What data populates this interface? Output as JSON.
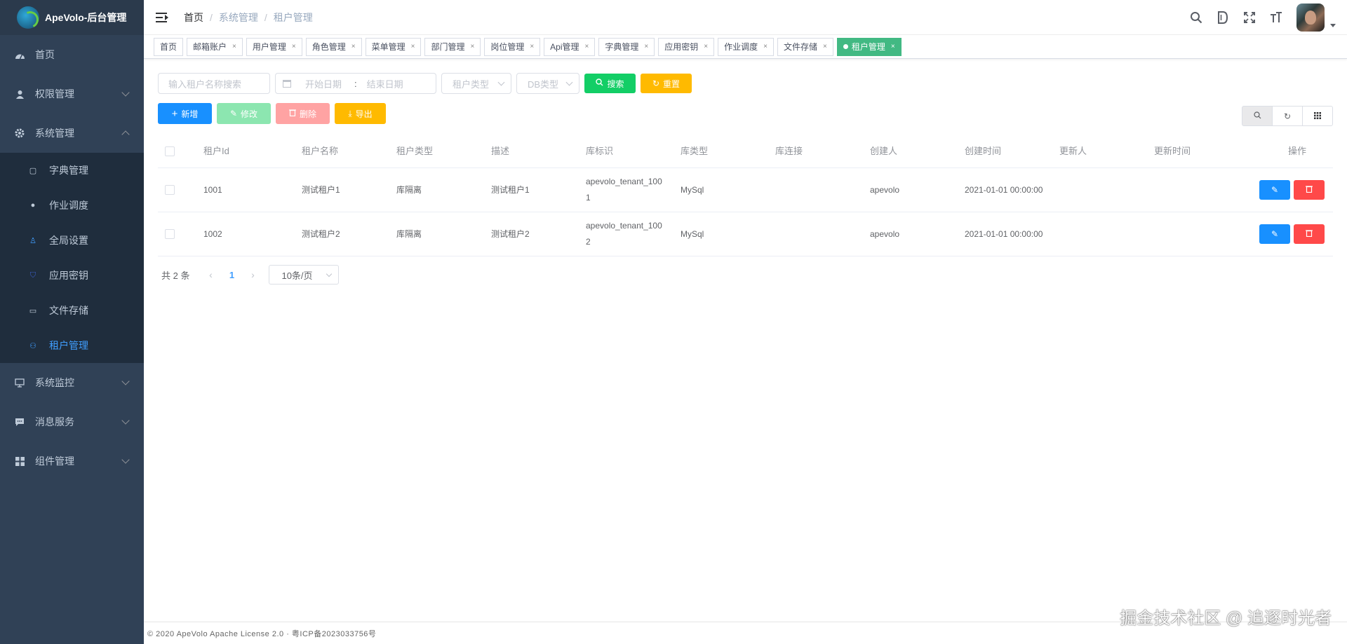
{
  "app": {
    "title": "ApeVolo-后台管理"
  },
  "sidebar": {
    "items": [
      {
        "label": "首页",
        "icon": "dashboard-icon"
      },
      {
        "label": "权限管理",
        "icon": "user-permission-icon"
      },
      {
        "label": "系统管理",
        "icon": "system-gear-icon"
      },
      {
        "label": "系统监控",
        "icon": "monitor-icon"
      },
      {
        "label": "消息服务",
        "icon": "message-icon"
      },
      {
        "label": "组件管理",
        "icon": "component-grid-icon"
      }
    ],
    "submenu": [
      {
        "label": "字典管理",
        "icon": "dictionary-icon"
      },
      {
        "label": "作业调度",
        "icon": "clock-icon"
      },
      {
        "label": "全局设置",
        "icon": "settings-person-icon"
      },
      {
        "label": "应用密钥",
        "icon": "shield-icon"
      },
      {
        "label": "文件存储",
        "icon": "folder-icon"
      },
      {
        "label": "租户管理",
        "icon": "tenant-icon"
      }
    ]
  },
  "breadcrumb": [
    "首页",
    "系统管理",
    "租户管理"
  ],
  "tags": [
    "首页",
    "邮箱账户",
    "用户管理",
    "角色管理",
    "菜单管理",
    "部门管理",
    "岗位管理",
    "Api管理",
    "字典管理",
    "应用密钥",
    "作业调度",
    "文件存储",
    "租户管理"
  ],
  "filters": {
    "search_placeholder": "输入租户名称搜索",
    "date_start": "开始日期",
    "date_sep": ":",
    "date_end": "结束日期",
    "tenant_type": "租户类型",
    "db_type": "DB类型",
    "search_btn": "搜索",
    "reset_btn": "重置"
  },
  "actions": {
    "add": "新增",
    "edit": "修改",
    "delete": "删除",
    "export": "导出"
  },
  "table": {
    "columns": [
      "租户Id",
      "租户名称",
      "租户类型",
      "描述",
      "库标识",
      "库类型",
      "库连接",
      "创建人",
      "创建时间",
      "更新人",
      "更新时间",
      "操作"
    ],
    "rows": [
      {
        "id": "1001",
        "name": "测试租户1",
        "type": "库隔离",
        "desc": "测试租户1",
        "tag": "apevolo_tenant_1001",
        "db_type": "MySql",
        "conn": "",
        "created_by": "apevolo",
        "created_at": "2021-01-01 00:00:00",
        "updated_by": "",
        "updated_at": ""
      },
      {
        "id": "1002",
        "name": "测试租户2",
        "type": "库隔离",
        "desc": "测试租户2",
        "tag": "apevolo_tenant_1002",
        "db_type": "MySql",
        "conn": "",
        "created_by": "apevolo",
        "created_at": "2021-01-01 00:00:00",
        "updated_by": "",
        "updated_at": ""
      }
    ]
  },
  "pagination": {
    "total": "共 2 条",
    "current": "1",
    "page_size": "10条/页"
  },
  "footer": {
    "text": "© 2020 ApeVolo Apache License 2.0 · 粤ICP备2023033756号"
  },
  "watermark": "掘金技术社区 @ 追逐时光者",
  "colors": {
    "sidebar_bg": "#304156",
    "active_tag": "#42b983",
    "primary": "#1890ff",
    "success": "#13ce66",
    "warning": "#ffba00",
    "danger": "#ff4949"
  }
}
